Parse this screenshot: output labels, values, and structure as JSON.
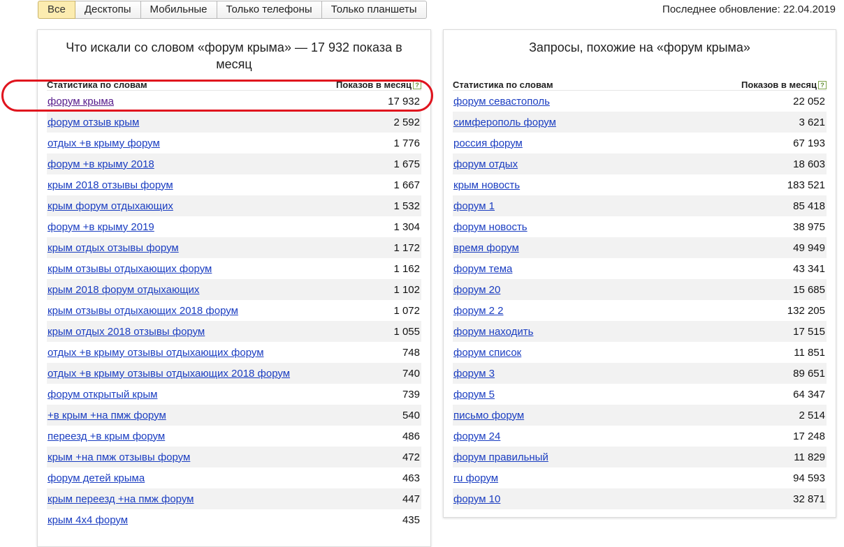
{
  "tabs": [
    {
      "label": "Все",
      "active": true
    },
    {
      "label": "Десктопы",
      "active": false
    },
    {
      "label": "Мобильные",
      "active": false
    },
    {
      "label": "Только телефоны",
      "active": false
    },
    {
      "label": "Только планшеты",
      "active": false
    }
  ],
  "last_update": "Последнее обновление: 22.04.2019",
  "left": {
    "title": "Что искали со словом «форум крыма» — 17 932 показа в месяц",
    "col_words": "Статистика по словам",
    "col_count": "Показов в месяц",
    "rows": [
      {
        "phrase": "форум крыма",
        "count": "17 932"
      },
      {
        "phrase": "форум отзыв крым",
        "count": "2 592"
      },
      {
        "phrase": "отдых +в крыму форум",
        "count": "1 776"
      },
      {
        "phrase": "форум +в крыму 2018",
        "count": "1 675"
      },
      {
        "phrase": "крым 2018 отзывы форум",
        "count": "1 667"
      },
      {
        "phrase": "крым форум отдыхающих",
        "count": "1 532"
      },
      {
        "phrase": "форум +в крыму 2019",
        "count": "1 304"
      },
      {
        "phrase": "крым отдых отзывы форум",
        "count": "1 172"
      },
      {
        "phrase": "крым отзывы отдыхающих форум",
        "count": "1 162"
      },
      {
        "phrase": "крым 2018 форум отдыхающих",
        "count": "1 102"
      },
      {
        "phrase": "крым отзывы отдыхающих 2018 форум",
        "count": "1 072"
      },
      {
        "phrase": "крым отдых 2018 отзывы форум",
        "count": "1 055"
      },
      {
        "phrase": "отдых +в крыму отзывы отдыхающих форум",
        "count": "748"
      },
      {
        "phrase": "отдых +в крыму отзывы отдыхающих 2018 форум",
        "count": "740"
      },
      {
        "phrase": "форум открытый крым",
        "count": "739"
      },
      {
        "phrase": "+в крым +на пмж форум",
        "count": "540"
      },
      {
        "phrase": "переезд +в крым форум",
        "count": "486"
      },
      {
        "phrase": "крым +на пмж отзывы форум",
        "count": "472"
      },
      {
        "phrase": "форум детей крыма",
        "count": "463"
      },
      {
        "phrase": "крым переезд +на пмж форум",
        "count": "447"
      },
      {
        "phrase": "крым 4х4 форум",
        "count": "435"
      }
    ]
  },
  "right": {
    "title": "Запросы, похожие на «форум крыма»",
    "col_words": "Статистика по словам",
    "col_count": "Показов в месяц",
    "rows": [
      {
        "phrase": "форум севастополь",
        "count": "22 052"
      },
      {
        "phrase": "симферополь форум",
        "count": "3 621"
      },
      {
        "phrase": "россия форум",
        "count": "67 193"
      },
      {
        "phrase": "форум отдых",
        "count": "18 603"
      },
      {
        "phrase": "крым новость",
        "count": "183 521"
      },
      {
        "phrase": "форум 1",
        "count": "85 418"
      },
      {
        "phrase": "форум новость",
        "count": "38 975"
      },
      {
        "phrase": "время форум",
        "count": "49 949"
      },
      {
        "phrase": "форум тема",
        "count": "43 341"
      },
      {
        "phrase": "форум 20",
        "count": "15 685"
      },
      {
        "phrase": "форум 2 2",
        "count": "132 205"
      },
      {
        "phrase": "форум находить",
        "count": "17 515"
      },
      {
        "phrase": "форум список",
        "count": "11 851"
      },
      {
        "phrase": "форум 3",
        "count": "89 651"
      },
      {
        "phrase": "форум 5",
        "count": "64 347"
      },
      {
        "phrase": "письмо форум",
        "count": "2 514"
      },
      {
        "phrase": "форум 24",
        "count": "17 248"
      },
      {
        "phrase": "форум правильный",
        "count": "11 829"
      },
      {
        "phrase": "ru форум",
        "count": "94 593"
      },
      {
        "phrase": "форум 10",
        "count": "32 871"
      }
    ]
  },
  "colors": {
    "link": "#1a3dc1",
    "visited": "#551a8b",
    "active_tab": "#fcecb0",
    "highlight": "#e0141e"
  }
}
